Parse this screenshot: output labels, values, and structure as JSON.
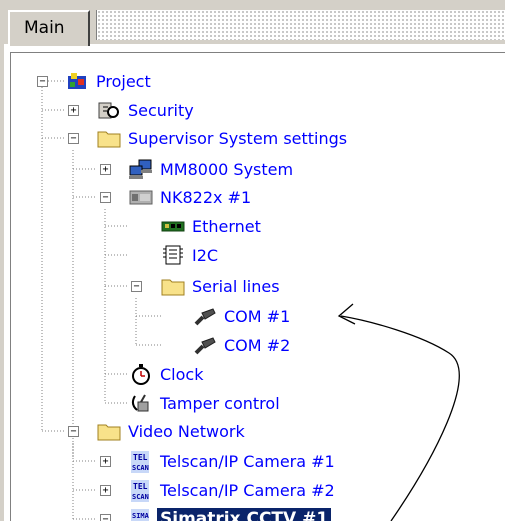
{
  "tabs": [
    {
      "label": "Main"
    }
  ],
  "tree": {
    "nodes": [
      {
        "id": "project",
        "label": "Project",
        "icon": "project-icon",
        "expander": "minus"
      },
      {
        "id": "security",
        "label": "Security",
        "icon": "keys-icon",
        "expander": "plus"
      },
      {
        "id": "supervisor",
        "label": "Supervisor System settings",
        "icon": "folder-icon",
        "expander": "minus"
      },
      {
        "id": "mm8000",
        "label": "MM8000 System",
        "icon": "network-computers-icon",
        "expander": "plus"
      },
      {
        "id": "nk822x",
        "label": "NK822x #1",
        "icon": "device-module-icon",
        "expander": "minus"
      },
      {
        "id": "ethernet",
        "label": "Ethernet",
        "icon": "network-card-icon",
        "expander": ""
      },
      {
        "id": "i2c",
        "label": "I2C",
        "icon": "chip-icon",
        "expander": ""
      },
      {
        "id": "serial",
        "label": "Serial lines",
        "icon": "folder-icon",
        "expander": "minus"
      },
      {
        "id": "com1",
        "label": "COM #1",
        "icon": "serial-connector-icon",
        "expander": ""
      },
      {
        "id": "com2",
        "label": "COM #2",
        "icon": "serial-connector-icon",
        "expander": ""
      },
      {
        "id": "clock",
        "label": "Clock",
        "icon": "stopwatch-icon",
        "expander": ""
      },
      {
        "id": "tamper",
        "label": "Tamper control",
        "icon": "tamper-switch-icon",
        "expander": ""
      },
      {
        "id": "video",
        "label": "Video Network",
        "icon": "folder-icon",
        "expander": "minus"
      },
      {
        "id": "telscan1",
        "label": "Telscan/IP Camera #1",
        "icon": "telscan-icon",
        "icon_text": "TEL SCAN",
        "expander": "plus"
      },
      {
        "id": "telscan2",
        "label": "Telscan/IP Camera #2",
        "icon": "telscan-icon",
        "icon_text": "TEL SCAN",
        "expander": "plus"
      },
      {
        "id": "simatrix",
        "label": "Simatrix CCTV #1",
        "icon": "simatrix-icon",
        "icon_text": "SIMA TRIX",
        "expander": "minus",
        "selected": true
      }
    ]
  },
  "colors": {
    "label": "#0000ff",
    "selection": "#0a246a",
    "tree_lines": "#808080",
    "annotation_arrow": "#000000"
  }
}
